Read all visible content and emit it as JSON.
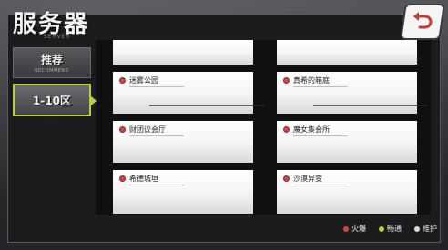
{
  "header": {
    "title": "服务器",
    "title_sub": "SERVER"
  },
  "back_button": {
    "icon": "back-arrow-icon"
  },
  "tabs": [
    {
      "label": "推荐",
      "sub": "RECOMMEND"
    },
    {
      "label": "1-10区",
      "sub": ""
    }
  ],
  "servers": {
    "blank_1": "",
    "blank_2": "",
    "s1": {
      "name": "迷雾公园",
      "status": "火爆"
    },
    "s2": {
      "name": "真希的箱庭",
      "status": "火爆"
    },
    "s3": {
      "name": "财团议会厅",
      "status": "火爆"
    },
    "s4": {
      "name": "魔女集会所",
      "status": "火爆"
    },
    "s5": {
      "name": "希德城垣",
      "status": "火爆"
    },
    "s6": {
      "name": "沙漠异变",
      "status": "火爆"
    }
  },
  "legend": {
    "hot": {
      "label": "火爆",
      "color": "#d24545"
    },
    "smooth": {
      "label": "畅通",
      "color": "#b6d335"
    },
    "maintenance": {
      "label": "维护",
      "color": "#dddddd"
    }
  },
  "colors": {
    "accent": "#b6d335",
    "hot": "#d24545"
  }
}
